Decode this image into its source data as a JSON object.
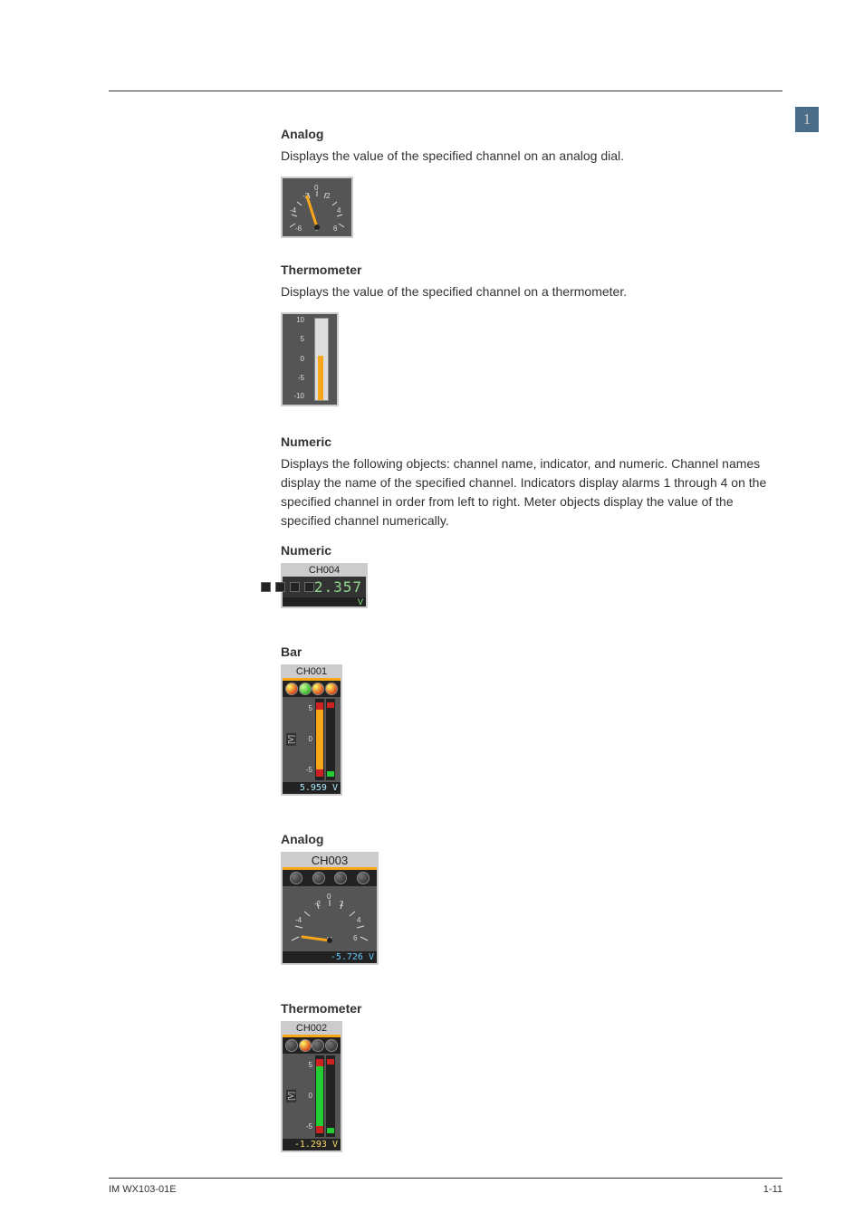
{
  "header": {
    "section_number": "1"
  },
  "blocks": {
    "analog": {
      "heading": "Analog",
      "desc": "Displays the value of the specified channel on an analog dial."
    },
    "thermometer": {
      "heading": "Thermometer",
      "desc": "Displays the value of the specified channel on a thermometer.",
      "scale": [
        "10",
        "5",
        "0",
        "-5",
        "-10"
      ]
    },
    "numeric": {
      "heading": "Numeric",
      "desc_l1": "Displays the following objects: channel name, indicator, and numeric. Channel names display the name of the specified channel.",
      "desc_l2": "Indicators display alarms 1 through 4 on the specified channel in order from left to right.",
      "desc_l3": "Meter objects display the value of the specified channel numerically.",
      "sub": "Numeric"
    },
    "bar": {
      "heading": "Bar"
    },
    "analog_alarm": {
      "heading": "Analog"
    },
    "thermo_alarm": {
      "heading": "Thermometer"
    }
  },
  "widgets": {
    "numeric": {
      "channel": "CH004",
      "value": "2.357",
      "unit": "V"
    },
    "bar": {
      "channel": "CH001",
      "scale": [
        "5",
        "0",
        "-5"
      ],
      "readout": "5.959  V"
    },
    "dial": {
      "channel": "CH003",
      "readout": "-5.726  V"
    },
    "thermo": {
      "channel": "CH002",
      "scale": [
        "5",
        "0",
        "-5"
      ],
      "readout": "-1.293  V"
    }
  },
  "footer": {
    "doc_id": "IM WX103-01E",
    "page": "1-11"
  }
}
